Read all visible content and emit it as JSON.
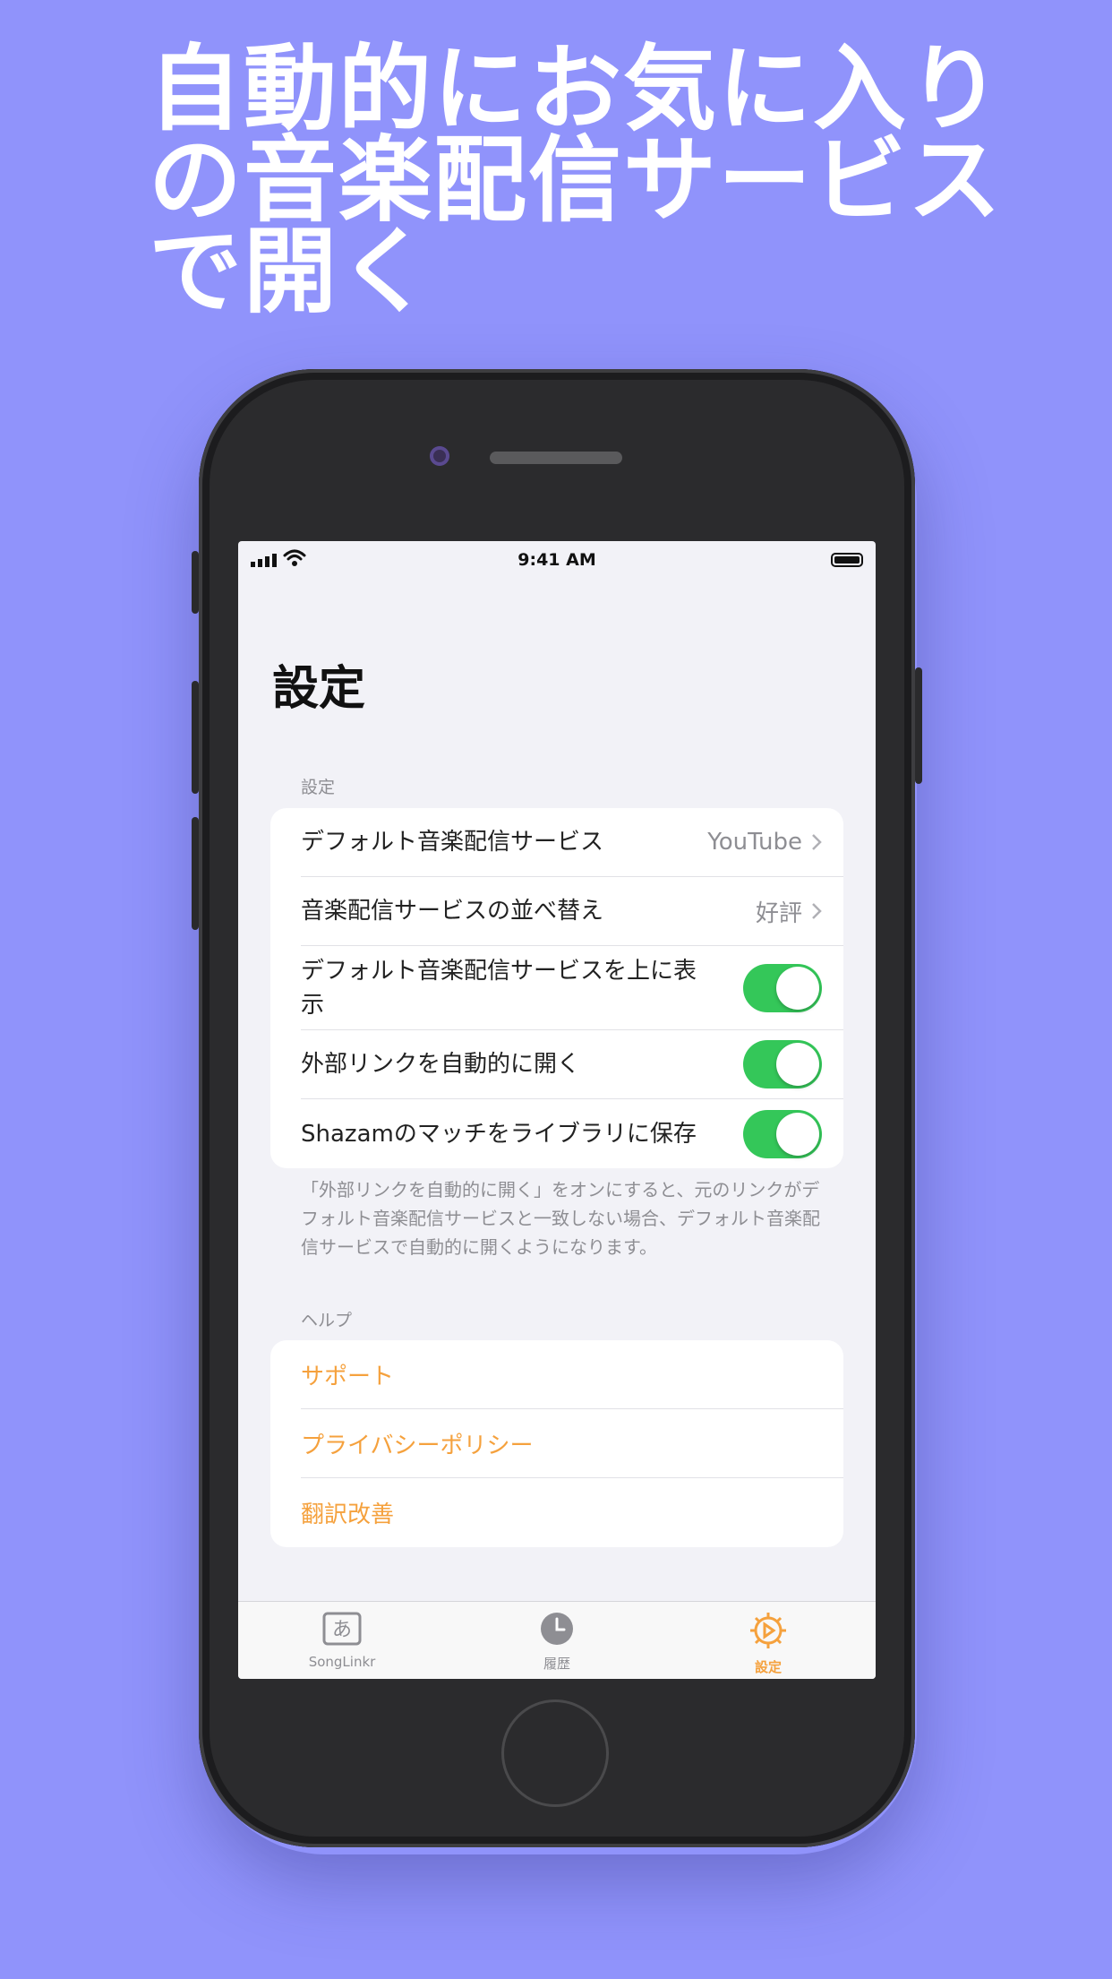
{
  "headline": "自動的にお気に入り\nの音楽配信サービス\nで開く",
  "status_bar": {
    "time": "9:41 AM"
  },
  "page_title": "設定",
  "settings_section": {
    "header": "設定",
    "rows": [
      {
        "label": "デフォルト音楽配信サービス",
        "value": "YouTube"
      },
      {
        "label": "音楽配信サービスの並べ替え",
        "value": "好評"
      },
      {
        "label": "デフォルト音楽配信サービスを上に表示",
        "toggle": true
      },
      {
        "label": "外部リンクを自動的に開く",
        "toggle": true
      },
      {
        "label": "Shazamのマッチをライブラリに保存",
        "toggle": true
      }
    ],
    "footer": "「外部リンクを自動的に開く」をオンにすると、元のリンクがデフォルト音楽配信サービスと一致しない場合、デフォルト音楽配信サービスで自動的に開くようになります。"
  },
  "help_section": {
    "header": "ヘルプ",
    "links": [
      "サポート",
      "プライバシーポリシー",
      "翻訳改善"
    ]
  },
  "tabbar": {
    "tabs": [
      {
        "label": "SongLinkr",
        "icon": "keyboard-a-icon"
      },
      {
        "label": "履歴",
        "icon": "clock-icon"
      },
      {
        "label": "設定",
        "icon": "gear-icon",
        "selected": true
      }
    ]
  },
  "colors": {
    "background": "#9093fb",
    "accent": "#f5a13d",
    "toggle_on": "#34c759"
  }
}
